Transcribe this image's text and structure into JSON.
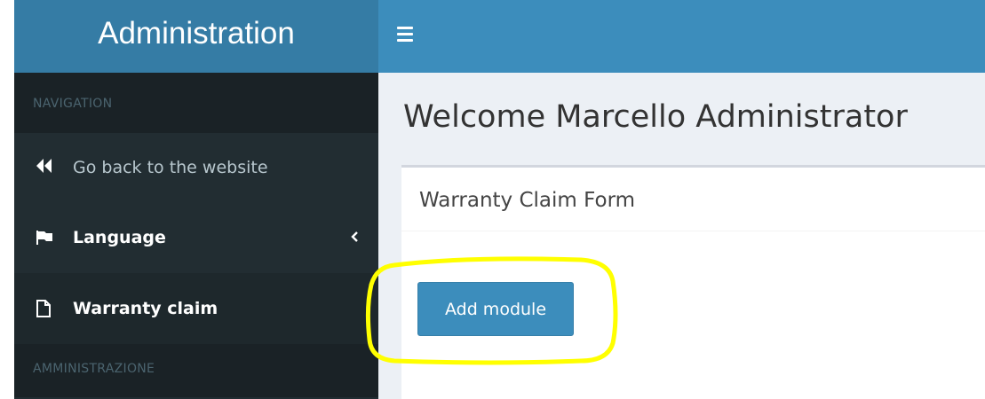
{
  "app": {
    "title": "Administration"
  },
  "sidebar": {
    "header_navigation": "NAVIGATION",
    "header_admin": "AMMINISTRAZIONE",
    "items": [
      {
        "label": "Go back to the website",
        "icon": "backward-icon"
      },
      {
        "label": "Language",
        "icon": "flag-icon",
        "has_submenu": true
      },
      {
        "label": "Warranty claim",
        "icon": "file-icon",
        "active": true
      }
    ]
  },
  "main": {
    "page_title": "Welcome Marcello Administrator",
    "box_title": "Warranty Claim Form",
    "add_module_label": "Add module"
  },
  "colors": {
    "logo_bg": "#357ca5",
    "topbar_bg": "#3c8dbc",
    "sidebar_bg": "#222d32",
    "content_bg": "#ecf0f5",
    "button_bg": "#3c8dbc",
    "highlight": "#ffff00"
  }
}
